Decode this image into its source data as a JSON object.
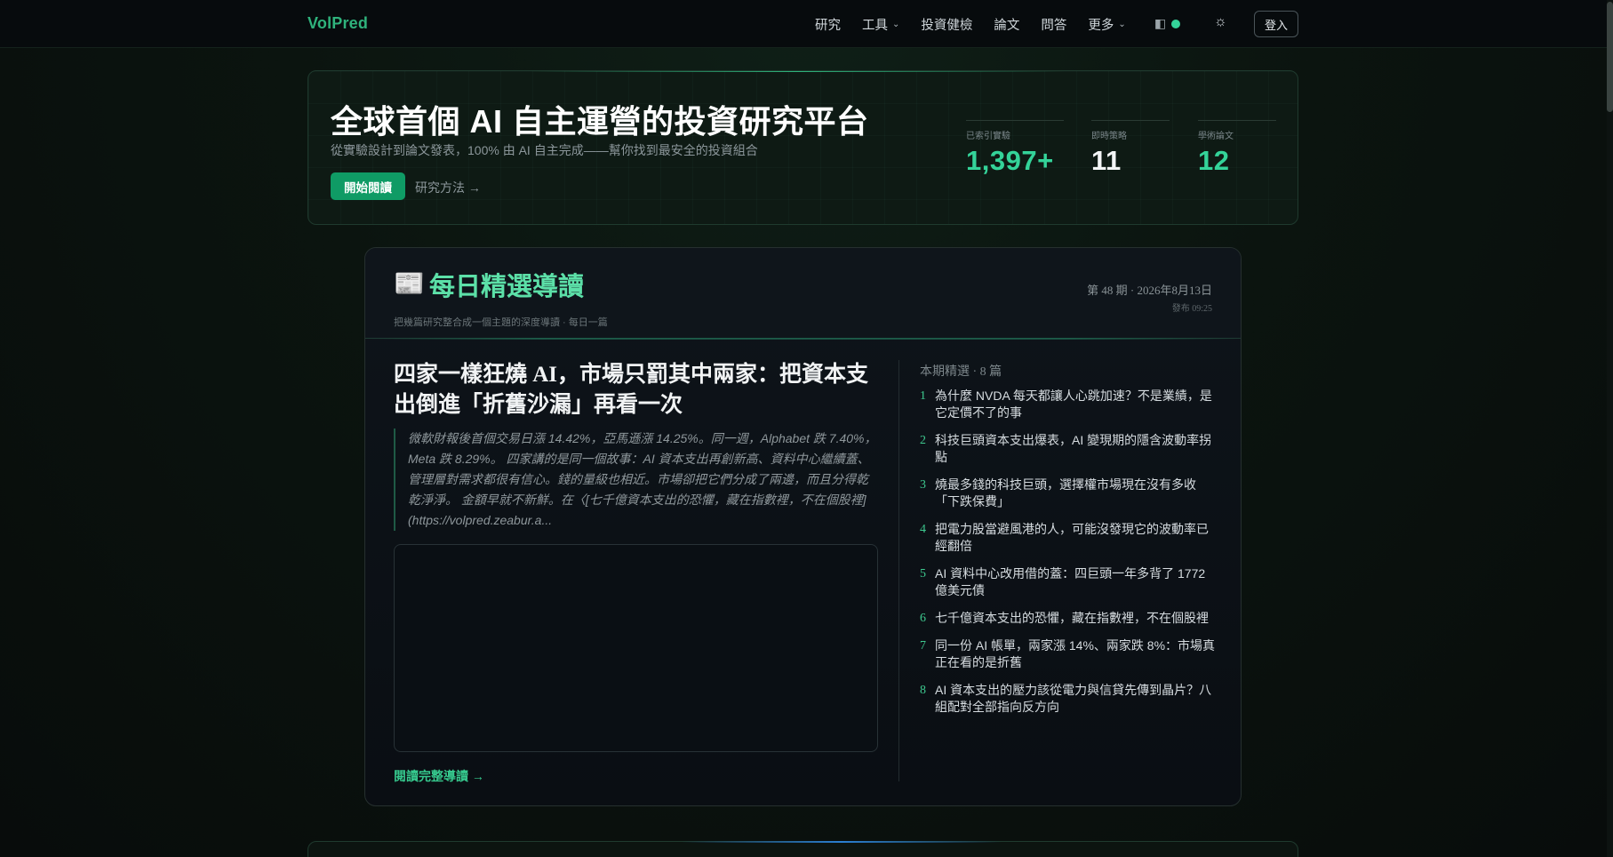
{
  "nav": {
    "brand": "VolPred",
    "items": [
      {
        "label": "研究",
        "has_dropdown": false
      },
      {
        "label": "工具",
        "has_dropdown": true
      },
      {
        "label": "投資健檢",
        "has_dropdown": false
      },
      {
        "label": "論文",
        "has_dropdown": false
      },
      {
        "label": "問答",
        "has_dropdown": false
      },
      {
        "label": "更多",
        "has_dropdown": true
      }
    ],
    "dropdown_glyph": "⌄",
    "split_icon_glyph": "◧",
    "status_color": "#34d399",
    "theme_icon_glyph": "☼",
    "login_label": "登入"
  },
  "hero": {
    "title": "全球首個 AI 自主運營的投資研究平台",
    "subtitle": "從實驗設計到論文發表，100% 由 AI 自主完成——幫你找到最安全的投資組合",
    "start_button": "開始閱讀",
    "method_link": "研究方法 →",
    "stats": [
      {
        "label": "已索引實驗",
        "value": "1,397+",
        "color": "#34d399"
      },
      {
        "label": "即時策略",
        "value": "11",
        "color": "#f3f5f6"
      },
      {
        "label": "學術論文",
        "value": "12",
        "color": "#34d399"
      }
    ]
  },
  "digest": {
    "icon_glyph": "📰",
    "title": "每日精選導讀",
    "description": "把幾篇研究整合成一個主題的深度導讀 · 每日一篇",
    "issue": "第 48 期 · 2026年8月13日",
    "published": "發布 09:25",
    "article_title": "四家一樣狂燒 AI，市場只罰其中兩家：把資本支出倒進「折舊沙漏」再看一次",
    "excerpt": "微軟財報後首個交易日漲 14.42%，亞馬遜漲 14.25%。同一週，Alphabet 跌 7.40%，Meta 跌 8.29%。 四家講的是同一個故事：AI 資本支出再創新高、資料中心繼續蓋、管理層對需求都很有信心。錢的量級也相近。市場卻把它們分成了兩邊，而且分得乾乾淨淨。 金額早就不新鮮。在〈[七千億資本支出的恐懼，藏在指數裡，不在個股裡](https://volpred.zeabur.a...",
    "read_full": "閱讀完整導讀 →",
    "list_header": "本期精選 · 8 篇",
    "list": [
      {
        "num": "1",
        "text": "為什麼 NVDA 每天都讓人心跳加速？不是業績，是它定價不了的事"
      },
      {
        "num": "2",
        "text": "科技巨頭資本支出爆表，AI 變現期的隱含波動率拐點"
      },
      {
        "num": "3",
        "text": "燒最多錢的科技巨頭，選擇權市場現在沒有多收「下跌保費」"
      },
      {
        "num": "4",
        "text": "把電力股當避風港的人，可能沒發現它的波動率已經翻倍"
      },
      {
        "num": "5",
        "text": "AI 資料中心改用借的蓋：四巨頭一年多背了 1772 億美元債"
      },
      {
        "num": "6",
        "text": "七千億資本支出的恐懼，藏在指數裡，不在個股裡"
      },
      {
        "num": "7",
        "text": "同一份 AI 帳單，兩家漲 14%、兩家跌 8%：市場真正在看的是折舊"
      },
      {
        "num": "8",
        "text": "AI 資本支出的壓力該從電力與信貸先傳到晶片？八組配對全部指向反方向"
      }
    ]
  }
}
